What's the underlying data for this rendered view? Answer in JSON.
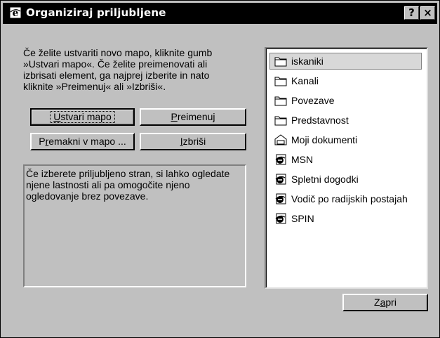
{
  "window": {
    "title": "Organiziraj priljubljene",
    "help_label": "?",
    "close_label": "×"
  },
  "instructions": "Če želite ustvariti novo mapo, kliknite gumb\n»Ustvari mapo«. Če želite preimenovati ali\nizbrisati element, ga najprej izberite in nato\nkliknite »Preimenuj« ali »Izbriši«.",
  "buttons": {
    "create_folder": {
      "pre": "",
      "u": "U",
      "post": "stvari mapo"
    },
    "rename": {
      "pre": "",
      "u": "P",
      "post": "reimenuj"
    },
    "move": {
      "pre": "P",
      "u": "r",
      "post": "emakni v mapo ..."
    },
    "delete": {
      "pre": "",
      "u": "I",
      "post": "zbriši"
    },
    "close": {
      "pre": "Z",
      "u": "a",
      "post": "pri"
    }
  },
  "info_text": "Če izberete priljubljeno stran, si lahko ogledate\nnjene lastnosti ali pa omogočite njeno\nogledovanje brez povezave.",
  "favorites": [
    {
      "label": "iskaniki",
      "icon": "folder-icon",
      "selected": true
    },
    {
      "label": "Kanali",
      "icon": "folder-icon"
    },
    {
      "label": "Povezave",
      "icon": "folder-icon"
    },
    {
      "label": "Predstavnost",
      "icon": "folder-icon"
    },
    {
      "label": "Moji dokumenti",
      "icon": "my-documents-icon"
    },
    {
      "label": "MSN",
      "icon": "ie-link-icon"
    },
    {
      "label": "Spletni dogodki",
      "icon": "ie-link-icon"
    },
    {
      "label": "Vodič po radijskih postajah",
      "icon": "ie-link-icon"
    },
    {
      "label": "SPIN",
      "icon": "ie-link-icon"
    }
  ]
}
